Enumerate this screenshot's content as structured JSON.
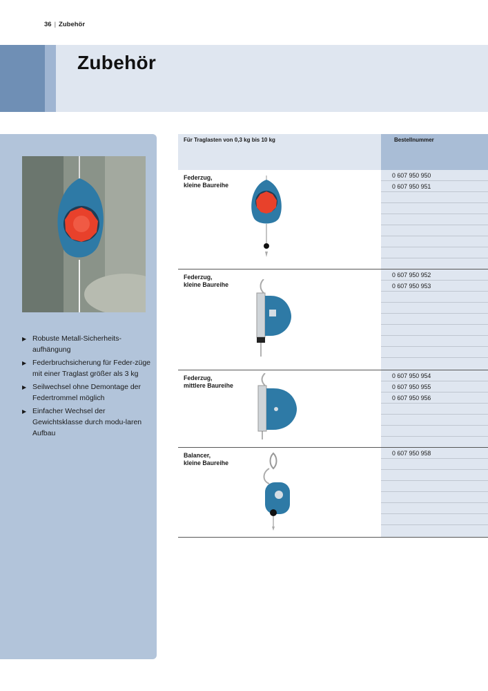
{
  "header": {
    "page_number": "36",
    "section": "Zubehör"
  },
  "banner": {
    "title": "Zubehör"
  },
  "sidebar": {
    "features": [
      "Robuste Metall-Sicherheits-aufhängung",
      "Federbruchsicherung für Feder-züge mit einer Traglast größer als 3 kg",
      "Seilwechsel ohne Demontage der Federtrommel möglich",
      "Einfacher Wechsel der Gewichtsklasse durch modu-laren Aufbau"
    ]
  },
  "table": {
    "header_left": "Für Traglasten von 0,3 kg bis 10 kg",
    "header_right": "Bestellnummer",
    "rows": [
      {
        "label_line1": "Federzug,",
        "label_line2": "kleine Baureihe",
        "numbers": [
          "0 607 950 950",
          "0 607 950 951",
          "",
          "",
          "",
          "",
          "",
          "",
          ""
        ]
      },
      {
        "label_line1": "Federzug,",
        "label_line2": "kleine Baureihe",
        "numbers": [
          "0 607 950 952",
          "0 607 950 953",
          "",
          "",
          "",
          "",
          "",
          "",
          ""
        ]
      },
      {
        "label_line1": "Federzug,",
        "label_line2": "mittlere Baureihe",
        "numbers": [
          "0 607 950 954",
          "0 607 950 955",
          "0 607 950 956",
          "",
          "",
          "",
          ""
        ]
      },
      {
        "label_line1": "Balancer,",
        "label_line2": "kleine Baureihe",
        "numbers": [
          "0 607 950 958",
          "",
          "",
          "",
          "",
          "",
          "",
          ""
        ]
      }
    ]
  },
  "colors": {
    "banner_dark": "#6f8fb5",
    "banner_light": "#dfe6f0",
    "sidebar": "#b2c4da",
    "product_blue": "#2e7aa6",
    "knob_red": "#e8412b"
  }
}
